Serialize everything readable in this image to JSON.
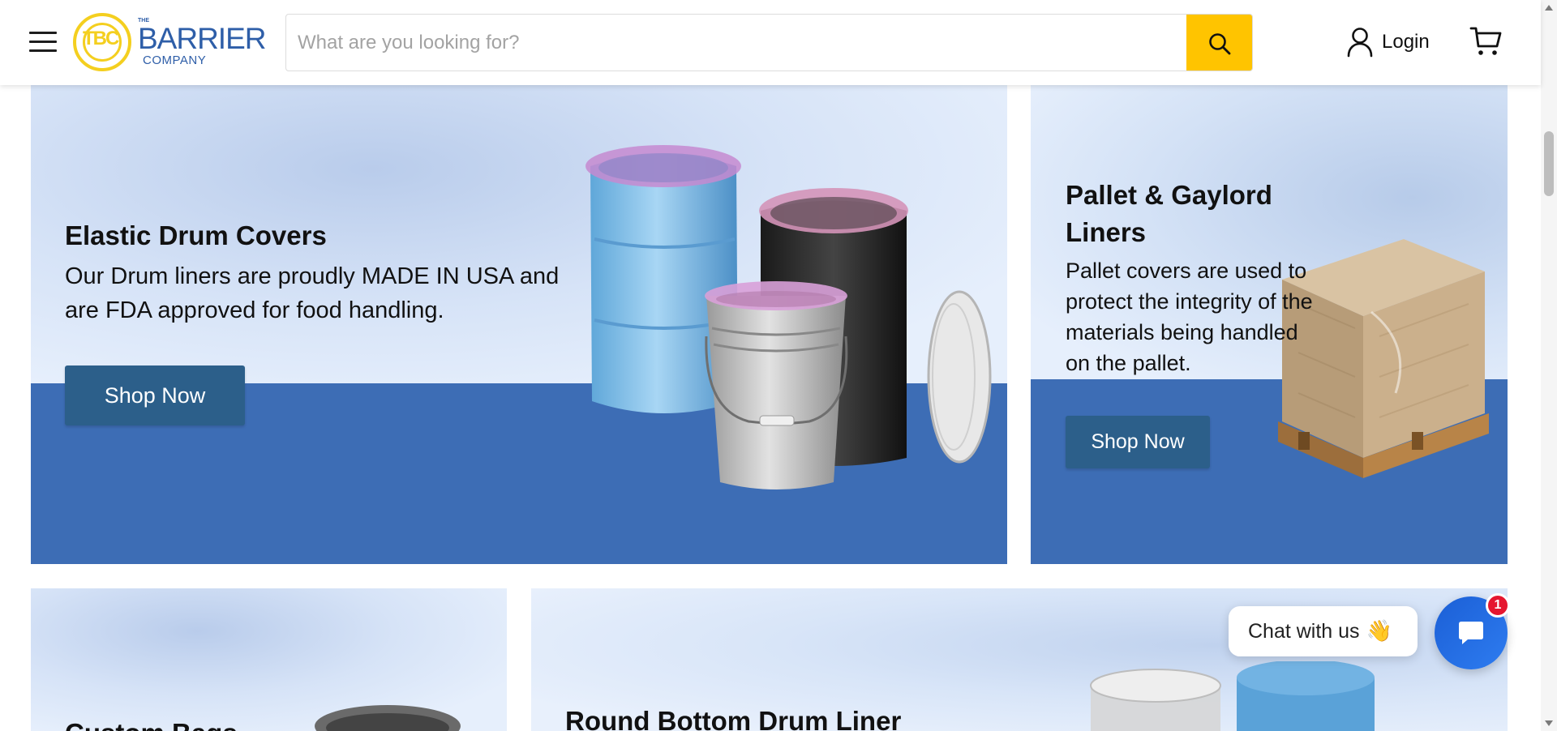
{
  "header": {
    "logo": {
      "small": "THE",
      "name": "BARRIER",
      "sub": "COMPANY"
    },
    "search": {
      "placeholder": "What are you looking for?",
      "value": ""
    },
    "login_label": "Login"
  },
  "banners": [
    {
      "title": "Elastic Drum Covers",
      "description": "Our Drum liners are proudly MADE IN USA and are FDA approved for food handling.",
      "button": "Shop Now"
    },
    {
      "title": "Pallet & Gaylord Liners",
      "description": "Pallet covers are used to protect the integrity of the materials being handled on the pallet.",
      "button": "Shop Now"
    },
    {
      "title": "Custom Bags"
    },
    {
      "title": "Round Bottom Drum Liner"
    }
  ],
  "chat": {
    "label": "Chat with us",
    "emoji": "👋",
    "badge": "1"
  },
  "colors": {
    "brand_blue": "#2e5ea8",
    "brand_yellow": "#f4cf1f",
    "search_button": "#ffc400",
    "shop_button": "#2c5f8a",
    "banner_floor": "#3d6db5",
    "chat_badge": "#e5162f"
  },
  "icons": [
    "menu-icon",
    "search-icon",
    "user-icon",
    "cart-icon",
    "chat-icon"
  ]
}
